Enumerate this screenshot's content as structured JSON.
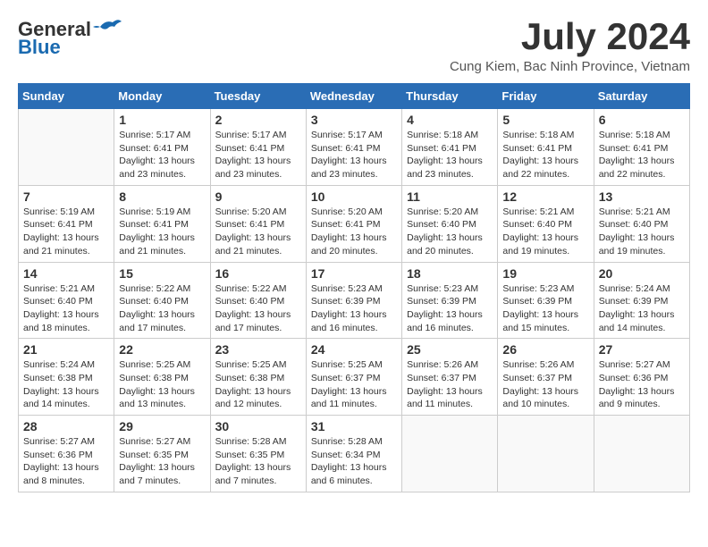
{
  "logo": {
    "line1": "General",
    "line2": "Blue"
  },
  "title": "July 2024",
  "location": "Cung Kiem, Bac Ninh Province, Vietnam",
  "days_of_week": [
    "Sunday",
    "Monday",
    "Tuesday",
    "Wednesday",
    "Thursday",
    "Friday",
    "Saturday"
  ],
  "weeks": [
    [
      {
        "day": "",
        "info": ""
      },
      {
        "day": "1",
        "info": "Sunrise: 5:17 AM\nSunset: 6:41 PM\nDaylight: 13 hours\nand 23 minutes."
      },
      {
        "day": "2",
        "info": "Sunrise: 5:17 AM\nSunset: 6:41 PM\nDaylight: 13 hours\nand 23 minutes."
      },
      {
        "day": "3",
        "info": "Sunrise: 5:17 AM\nSunset: 6:41 PM\nDaylight: 13 hours\nand 23 minutes."
      },
      {
        "day": "4",
        "info": "Sunrise: 5:18 AM\nSunset: 6:41 PM\nDaylight: 13 hours\nand 23 minutes."
      },
      {
        "day": "5",
        "info": "Sunrise: 5:18 AM\nSunset: 6:41 PM\nDaylight: 13 hours\nand 22 minutes."
      },
      {
        "day": "6",
        "info": "Sunrise: 5:18 AM\nSunset: 6:41 PM\nDaylight: 13 hours\nand 22 minutes."
      }
    ],
    [
      {
        "day": "7",
        "info": "Sunrise: 5:19 AM\nSunset: 6:41 PM\nDaylight: 13 hours\nand 21 minutes."
      },
      {
        "day": "8",
        "info": "Sunrise: 5:19 AM\nSunset: 6:41 PM\nDaylight: 13 hours\nand 21 minutes."
      },
      {
        "day": "9",
        "info": "Sunrise: 5:20 AM\nSunset: 6:41 PM\nDaylight: 13 hours\nand 21 minutes."
      },
      {
        "day": "10",
        "info": "Sunrise: 5:20 AM\nSunset: 6:41 PM\nDaylight: 13 hours\nand 20 minutes."
      },
      {
        "day": "11",
        "info": "Sunrise: 5:20 AM\nSunset: 6:40 PM\nDaylight: 13 hours\nand 20 minutes."
      },
      {
        "day": "12",
        "info": "Sunrise: 5:21 AM\nSunset: 6:40 PM\nDaylight: 13 hours\nand 19 minutes."
      },
      {
        "day": "13",
        "info": "Sunrise: 5:21 AM\nSunset: 6:40 PM\nDaylight: 13 hours\nand 19 minutes."
      }
    ],
    [
      {
        "day": "14",
        "info": "Sunrise: 5:21 AM\nSunset: 6:40 PM\nDaylight: 13 hours\nand 18 minutes."
      },
      {
        "day": "15",
        "info": "Sunrise: 5:22 AM\nSunset: 6:40 PM\nDaylight: 13 hours\nand 17 minutes."
      },
      {
        "day": "16",
        "info": "Sunrise: 5:22 AM\nSunset: 6:40 PM\nDaylight: 13 hours\nand 17 minutes."
      },
      {
        "day": "17",
        "info": "Sunrise: 5:23 AM\nSunset: 6:39 PM\nDaylight: 13 hours\nand 16 minutes."
      },
      {
        "day": "18",
        "info": "Sunrise: 5:23 AM\nSunset: 6:39 PM\nDaylight: 13 hours\nand 16 minutes."
      },
      {
        "day": "19",
        "info": "Sunrise: 5:23 AM\nSunset: 6:39 PM\nDaylight: 13 hours\nand 15 minutes."
      },
      {
        "day": "20",
        "info": "Sunrise: 5:24 AM\nSunset: 6:39 PM\nDaylight: 13 hours\nand 14 minutes."
      }
    ],
    [
      {
        "day": "21",
        "info": "Sunrise: 5:24 AM\nSunset: 6:38 PM\nDaylight: 13 hours\nand 14 minutes."
      },
      {
        "day": "22",
        "info": "Sunrise: 5:25 AM\nSunset: 6:38 PM\nDaylight: 13 hours\nand 13 minutes."
      },
      {
        "day": "23",
        "info": "Sunrise: 5:25 AM\nSunset: 6:38 PM\nDaylight: 13 hours\nand 12 minutes."
      },
      {
        "day": "24",
        "info": "Sunrise: 5:25 AM\nSunset: 6:37 PM\nDaylight: 13 hours\nand 11 minutes."
      },
      {
        "day": "25",
        "info": "Sunrise: 5:26 AM\nSunset: 6:37 PM\nDaylight: 13 hours\nand 11 minutes."
      },
      {
        "day": "26",
        "info": "Sunrise: 5:26 AM\nSunset: 6:37 PM\nDaylight: 13 hours\nand 10 minutes."
      },
      {
        "day": "27",
        "info": "Sunrise: 5:27 AM\nSunset: 6:36 PM\nDaylight: 13 hours\nand 9 minutes."
      }
    ],
    [
      {
        "day": "28",
        "info": "Sunrise: 5:27 AM\nSunset: 6:36 PM\nDaylight: 13 hours\nand 8 minutes."
      },
      {
        "day": "29",
        "info": "Sunrise: 5:27 AM\nSunset: 6:35 PM\nDaylight: 13 hours\nand 7 minutes."
      },
      {
        "day": "30",
        "info": "Sunrise: 5:28 AM\nSunset: 6:35 PM\nDaylight: 13 hours\nand 7 minutes."
      },
      {
        "day": "31",
        "info": "Sunrise: 5:28 AM\nSunset: 6:34 PM\nDaylight: 13 hours\nand 6 minutes."
      },
      {
        "day": "",
        "info": ""
      },
      {
        "day": "",
        "info": ""
      },
      {
        "day": "",
        "info": ""
      }
    ]
  ]
}
